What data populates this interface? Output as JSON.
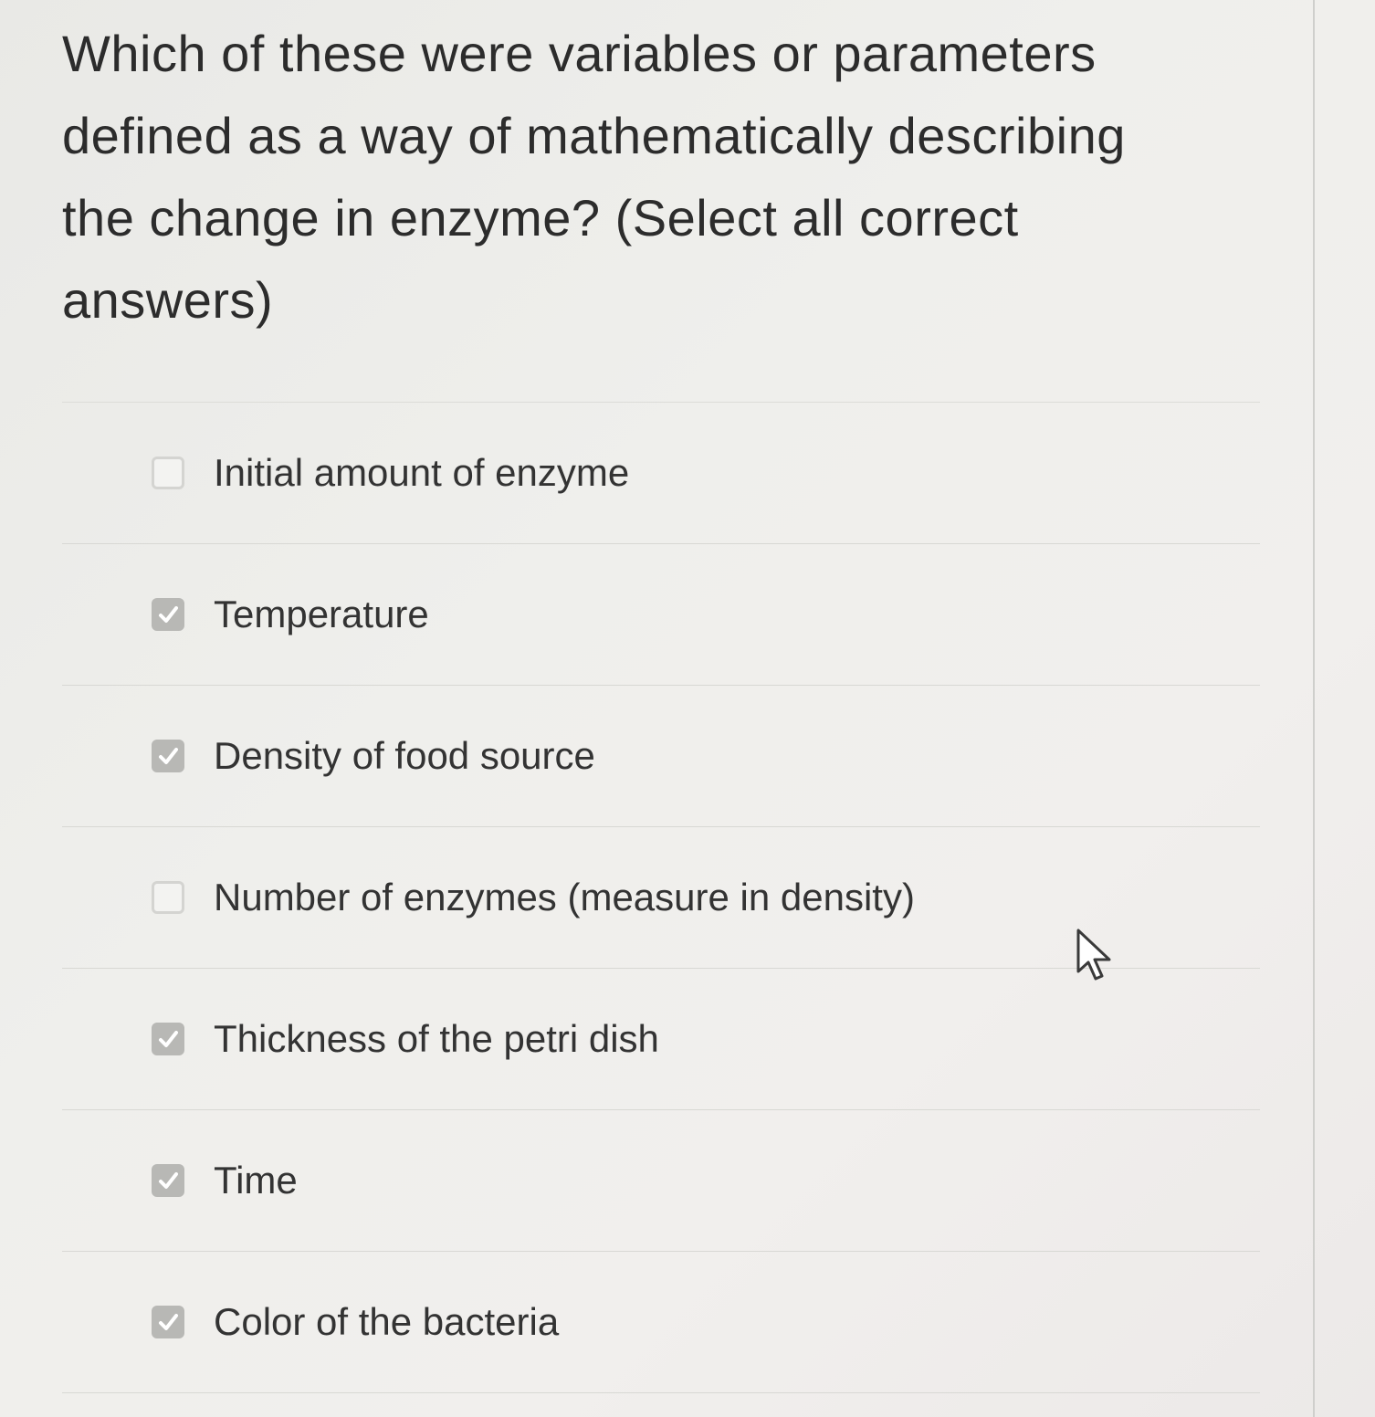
{
  "question": {
    "text": "Which of these were variables or parameters defined as a way of mathematically describing the change in enzyme? (Select all correct answers)"
  },
  "options": [
    {
      "label": "Initial amount of enzyme",
      "checked": false
    },
    {
      "label": "Temperature",
      "checked": true
    },
    {
      "label": "Density of food source",
      "checked": true
    },
    {
      "label": "Number of enzymes (measure in density)",
      "checked": false
    },
    {
      "label": "Thickness of the petri dish",
      "checked": true
    },
    {
      "label": "Time",
      "checked": true
    },
    {
      "label": "Color of the bacteria",
      "checked": true
    }
  ],
  "icons": {
    "check": "checkmark-icon",
    "cursor": "mouse-pointer-icon"
  },
  "colors": {
    "checked_fill": "#b8b8b5",
    "text": "#333333"
  }
}
